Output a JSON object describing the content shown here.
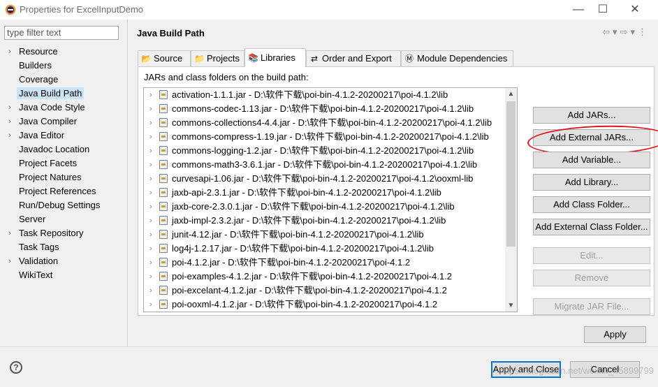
{
  "window": {
    "title": "Properties for ExcelInputDemo",
    "minimize": "—",
    "maximize": "☐",
    "close": "✕"
  },
  "sidebar": {
    "filter_placeholder": "type filter text",
    "items": [
      {
        "label": "Resource",
        "expandable": true
      },
      {
        "label": "Builders",
        "expandable": false
      },
      {
        "label": "Coverage",
        "expandable": false
      },
      {
        "label": "Java Build Path",
        "expandable": false,
        "selected": true
      },
      {
        "label": "Java Code Style",
        "expandable": true
      },
      {
        "label": "Java Compiler",
        "expandable": true
      },
      {
        "label": "Java Editor",
        "expandable": true
      },
      {
        "label": "Javadoc Location",
        "expandable": false
      },
      {
        "label": "Project Facets",
        "expandable": false
      },
      {
        "label": "Project Natures",
        "expandable": false
      },
      {
        "label": "Project References",
        "expandable": false
      },
      {
        "label": "Run/Debug Settings",
        "expandable": false
      },
      {
        "label": "Server",
        "expandable": false
      },
      {
        "label": "Task Repository",
        "expandable": true
      },
      {
        "label": "Task Tags",
        "expandable": false
      },
      {
        "label": "Validation",
        "expandable": true
      },
      {
        "label": "WikiText",
        "expandable": false
      }
    ]
  },
  "panel": {
    "title": "Java Build Path",
    "tabs": [
      {
        "label": "Source",
        "icon": "folder-icon"
      },
      {
        "label": "Projects",
        "icon": "project-folder-icon"
      },
      {
        "label": "Libraries",
        "icon": "library-books-icon",
        "active": true
      },
      {
        "label": "Order and Export",
        "icon": "order-export-icon"
      },
      {
        "label": "Module Dependencies",
        "icon": "module-icon"
      }
    ],
    "list_label": "JARs and class folders on the build path:",
    "jars": [
      "activation-1.1.1.jar - D:\\软件下载\\poi-bin-4.1.2-20200217\\poi-4.1.2\\lib",
      "commons-codec-1.13.jar - D:\\软件下载\\poi-bin-4.1.2-20200217\\poi-4.1.2\\lib",
      "commons-collections4-4.4.jar - D:\\软件下载\\poi-bin-4.1.2-20200217\\poi-4.1.2\\lib",
      "commons-compress-1.19.jar - D:\\软件下载\\poi-bin-4.1.2-20200217\\poi-4.1.2\\lib",
      "commons-logging-1.2.jar - D:\\软件下载\\poi-bin-4.1.2-20200217\\poi-4.1.2\\lib",
      "commons-math3-3.6.1.jar - D:\\软件下载\\poi-bin-4.1.2-20200217\\poi-4.1.2\\lib",
      "curvesapi-1.06.jar - D:\\软件下载\\poi-bin-4.1.2-20200217\\poi-4.1.2\\ooxml-lib",
      "jaxb-api-2.3.1.jar - D:\\软件下载\\poi-bin-4.1.2-20200217\\poi-4.1.2\\lib",
      "jaxb-core-2.3.0.1.jar - D:\\软件下载\\poi-bin-4.1.2-20200217\\poi-4.1.2\\lib",
      "jaxb-impl-2.3.2.jar - D:\\软件下载\\poi-bin-4.1.2-20200217\\poi-4.1.2\\lib",
      "junit-4.12.jar - D:\\软件下载\\poi-bin-4.1.2-20200217\\poi-4.1.2\\lib",
      "log4j-1.2.17.jar - D:\\软件下载\\poi-bin-4.1.2-20200217\\poi-4.1.2\\lib",
      "poi-4.1.2.jar - D:\\软件下载\\poi-bin-4.1.2-20200217\\poi-4.1.2",
      "poi-examples-4.1.2.jar - D:\\软件下载\\poi-bin-4.1.2-20200217\\poi-4.1.2",
      "poi-excelant-4.1.2.jar - D:\\软件下载\\poi-bin-4.1.2-20200217\\poi-4.1.2",
      "poi-ooxml-4.1.2.jar - D:\\软件下载\\poi-bin-4.1.2-20200217\\poi-4.1.2"
    ],
    "buttons": {
      "add_jars": "Add JARs...",
      "add_external_jars": "Add External JARs...",
      "add_variable": "Add Variable...",
      "add_library": "Add Library...",
      "add_class_folder": "Add Class Folder...",
      "add_external_class_folder": "Add External Class Folder...",
      "edit": "Edit...",
      "remove": "Remove",
      "migrate_jar": "Migrate JAR File..."
    },
    "apply": "Apply"
  },
  "footer": {
    "help": "?",
    "apply_and_close": "Apply and Close",
    "cancel": "Cancel",
    "watermark": "https://blog.csdn.net/weixin_45899799"
  },
  "colors": {
    "annotation_circle": "#e0151c",
    "selection": "#cce4f7",
    "default_button_border": "#0078d7"
  }
}
